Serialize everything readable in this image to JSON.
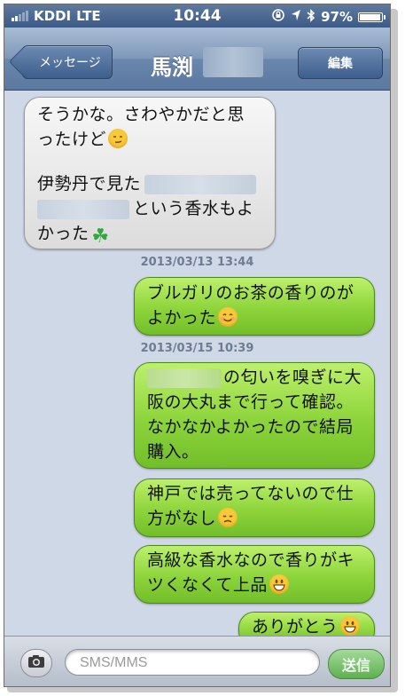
{
  "status": {
    "carrier": "KDDI",
    "network": "LTE",
    "time": "10:44",
    "battery": "97%"
  },
  "nav": {
    "back_label": "メッセージ",
    "title": "馬渕",
    "edit_label": "編集"
  },
  "messages": [
    {
      "dir": "in",
      "lines": [
        "そうかな。さわやかだと思",
        "ったけど",
        "",
        "伊勢丹で見た",
        "という香水もよ",
        "かった"
      ],
      "emoji": [
        "smirk",
        "clover"
      ]
    },
    {
      "dir": "ts",
      "text": "2013/03/13 13:44"
    },
    {
      "dir": "out",
      "lines": [
        "ブルガリのお茶の香りのが",
        "よかった"
      ],
      "emoji": [
        "smile"
      ]
    },
    {
      "dir": "ts",
      "text": "2013/03/15 10:39"
    },
    {
      "dir": "out",
      "lines": [
        "の匂いを嗅ぎに大",
        "阪の大丸まで行って確認。",
        "なかなかよかったので結局",
        "購入。"
      ]
    },
    {
      "dir": "out",
      "lines": [
        "神戸では売ってないので仕",
        "方がなし"
      ],
      "emoji": [
        "disappointed"
      ]
    },
    {
      "dir": "out",
      "lines": [
        "高級な香水なので香りがキ",
        "ツくなくて上品"
      ],
      "emoji": [
        "grin"
      ]
    },
    {
      "dir": "out",
      "lines": [
        "ありがとう"
      ],
      "emoji": [
        "grin"
      ]
    }
  ],
  "compose": {
    "placeholder": "SMS/MMS",
    "send_label": "送信"
  },
  "colors": {
    "incoming": "#e9e9e9",
    "outgoing": "#8dd43b",
    "nav": "#6a87ad",
    "background": "#cfd8e6"
  }
}
